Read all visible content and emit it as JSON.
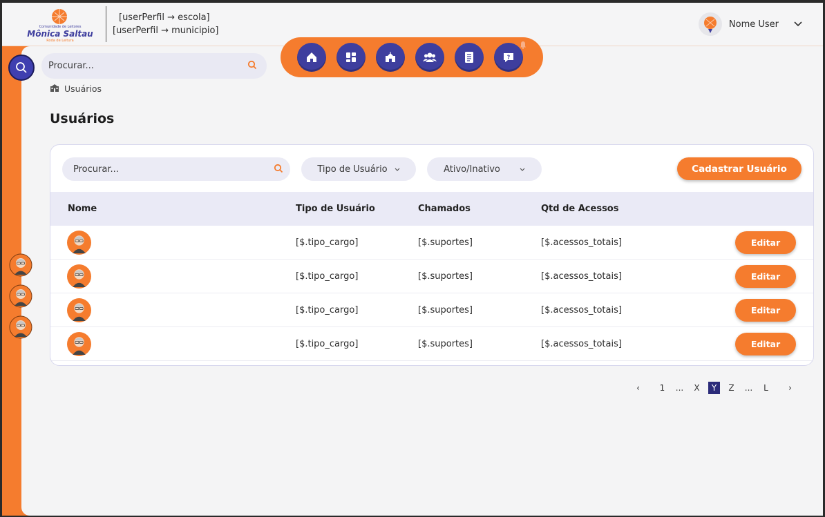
{
  "header": {
    "logo_text": "Mônica Saltau",
    "perfil_line1": "[userPerfil → escola]",
    "perfil_line2": "[userPerfil → municipio]",
    "user_name": "Nome User"
  },
  "search_top": {
    "placeholder": "Procurar..."
  },
  "breadcrumb": {
    "label": "Usuários"
  },
  "page_title": "Usuários",
  "nav": {
    "items": [
      "home-icon",
      "dashboard-icon",
      "school-icon",
      "users-group-icon",
      "report-icon",
      "support-icon"
    ]
  },
  "filters": {
    "search_placeholder": "Procurar...",
    "tipo_label": "Tipo de Usuário",
    "ativo_label": "Ativo/Inativo",
    "add_button": "Cadastrar Usuário"
  },
  "table": {
    "headers": [
      "Nome",
      "Tipo de Usuário",
      "Chamados",
      "Qtd de Acessos"
    ],
    "rows": [
      {
        "tipo": "[$.tipo_cargo]",
        "chamados": "[$.suportes]",
        "acessos": "[$.acessos_totais]",
        "action": "Editar"
      },
      {
        "tipo": "[$.tipo_cargo]",
        "chamados": "[$.suportes]",
        "acessos": "[$.acessos_totais]",
        "action": "Editar"
      },
      {
        "tipo": "[$.tipo_cargo]",
        "chamados": "[$.suportes]",
        "acessos": "[$.acessos_totais]",
        "action": "Editar"
      },
      {
        "tipo": "[$.tipo_cargo]",
        "chamados": "[$.suportes]",
        "acessos": "[$.acessos_totais]",
        "action": "Editar"
      }
    ]
  },
  "pagination": {
    "prev": "‹",
    "pages": [
      "1",
      "...",
      "X",
      "Y",
      "Z",
      "...",
      "L"
    ],
    "active": "Y",
    "next": "›"
  },
  "colors": {
    "accent": "#f57c2e",
    "nav": "#3e3e9e",
    "active_page": "#2b2b7a"
  }
}
